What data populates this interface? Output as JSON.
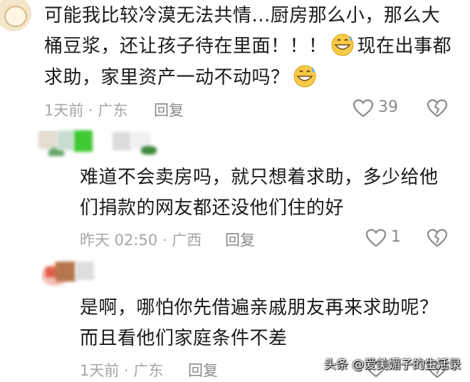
{
  "comments": [
    {
      "lines": [
        "可能我比较冷漠无法共情...厨房那么小，那么大",
        "桶豆浆，还让孩子待在里面！！！",
        "求助，家里资产一动不动吗？"
      ],
      "line2_tail": "现在出事都",
      "time_location": "1天前 · 广东",
      "reply_label": "回复",
      "like_count": "39",
      "emoji": "grinning-sweat-emoji"
    },
    {
      "lines": [
        "难道不会卖房吗，就只想着求助，多少给他",
        "们捐款的网友都还没他们住的好"
      ],
      "time_location": "昨天 02:50 · 广西",
      "reply_label": "回复",
      "like_count": "1"
    },
    {
      "lines": [
        "是啊，哪怕你先借遍亲戚朋友再来求助呢？",
        "而且看他们家庭条件不差"
      ],
      "time_location": "1天前 · 广东",
      "reply_label": "回复"
    }
  ],
  "watermark": "头条 @爱美媚子的生活录",
  "colors": {
    "meta_gray": "#a6a6a6",
    "text_dark": "#1a1a1a",
    "icon_gray": "#8a8a8a"
  }
}
